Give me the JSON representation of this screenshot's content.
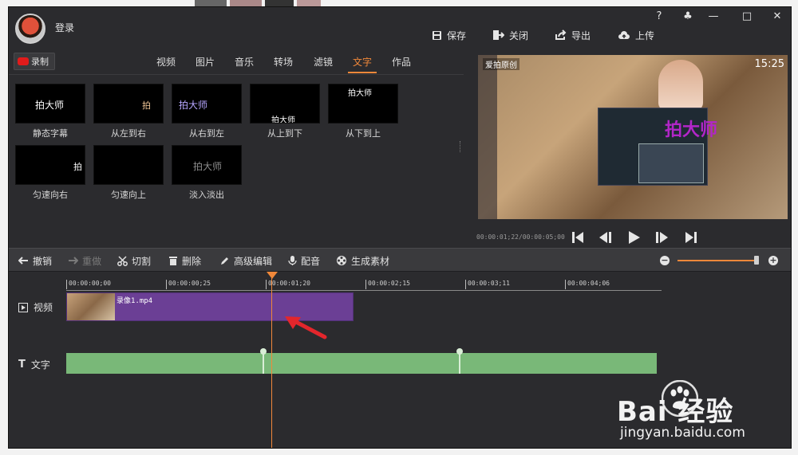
{
  "window": {
    "login": "登录",
    "controls": {
      "help": "?",
      "skin": "♣",
      "minimize": "—",
      "maximize": "□",
      "close": "✕"
    }
  },
  "top_actions": [
    {
      "label": "保存",
      "icon": "save-icon"
    },
    {
      "label": "关闭",
      "icon": "exit-icon"
    },
    {
      "label": "导出",
      "icon": "share-icon"
    },
    {
      "label": "上传",
      "icon": "cloud-upload-icon"
    }
  ],
  "record_label": "录制",
  "tabs": [
    "视频",
    "图片",
    "音乐",
    "转场",
    "滤镜",
    "文字",
    "作品"
  ],
  "active_tab": "文字",
  "tiles": [
    {
      "label": "静态字幕",
      "text": "拍大师",
      "color": "#ffffff"
    },
    {
      "label": "从左到右",
      "text": "拍",
      "color": "#ffffff"
    },
    {
      "label": "从右到左",
      "text": "拍大师",
      "color": "#b7a6ff"
    },
    {
      "label": "从上到下",
      "text": "拍大师",
      "color": "#ffffff"
    },
    {
      "label": "从下到上",
      "text": "拍大师",
      "color": "#ffffff"
    },
    {
      "label": "匀速向右",
      "text": "拍",
      "color": "#ffffff"
    },
    {
      "label": "匀速向上",
      "text": "",
      "color": "#ffffff"
    },
    {
      "label": "淡入淡出",
      "text": "拍大师",
      "color": "#8c8c8c"
    }
  ],
  "preview": {
    "timecode": "00:00:01;22/00:00:05;00",
    "watermark": "爱拍原创",
    "clock": "15:25",
    "overlay_text": "拍大师"
  },
  "toolbar": [
    {
      "label": "撤销",
      "icon": "undo-icon",
      "enabled": true
    },
    {
      "label": "重做",
      "icon": "redo-icon",
      "enabled": false
    },
    {
      "label": "切割",
      "icon": "scissors-icon",
      "enabled": true
    },
    {
      "label": "删除",
      "icon": "trash-icon",
      "enabled": true
    },
    {
      "label": "高级编辑",
      "icon": "pen-icon",
      "enabled": true
    },
    {
      "label": "配音",
      "icon": "microphone-icon",
      "enabled": true
    },
    {
      "label": "生成素材",
      "icon": "film-reel-icon",
      "enabled": true
    }
  ],
  "zoom": {
    "minus": "−",
    "plus": "+",
    "level": 1.0
  },
  "ruler_ticks": [
    "00:00:00;00",
    "00:00:00;25",
    "00:00:01;20",
    "00:00:02;15",
    "00:00:03;11",
    "00:00:04;06"
  ],
  "tracks": {
    "video_label": "视频",
    "text_label": "文字",
    "clip_name": "录像1.mp4"
  },
  "brand": {
    "watermark_main": "Bai 经验",
    "watermark_url": "jingyan.baidu.com"
  },
  "colors": {
    "accent": "#f0883a",
    "video_clip": "#6b3f95",
    "text_clip": "#79b878",
    "record_red": "#e11b1b"
  }
}
